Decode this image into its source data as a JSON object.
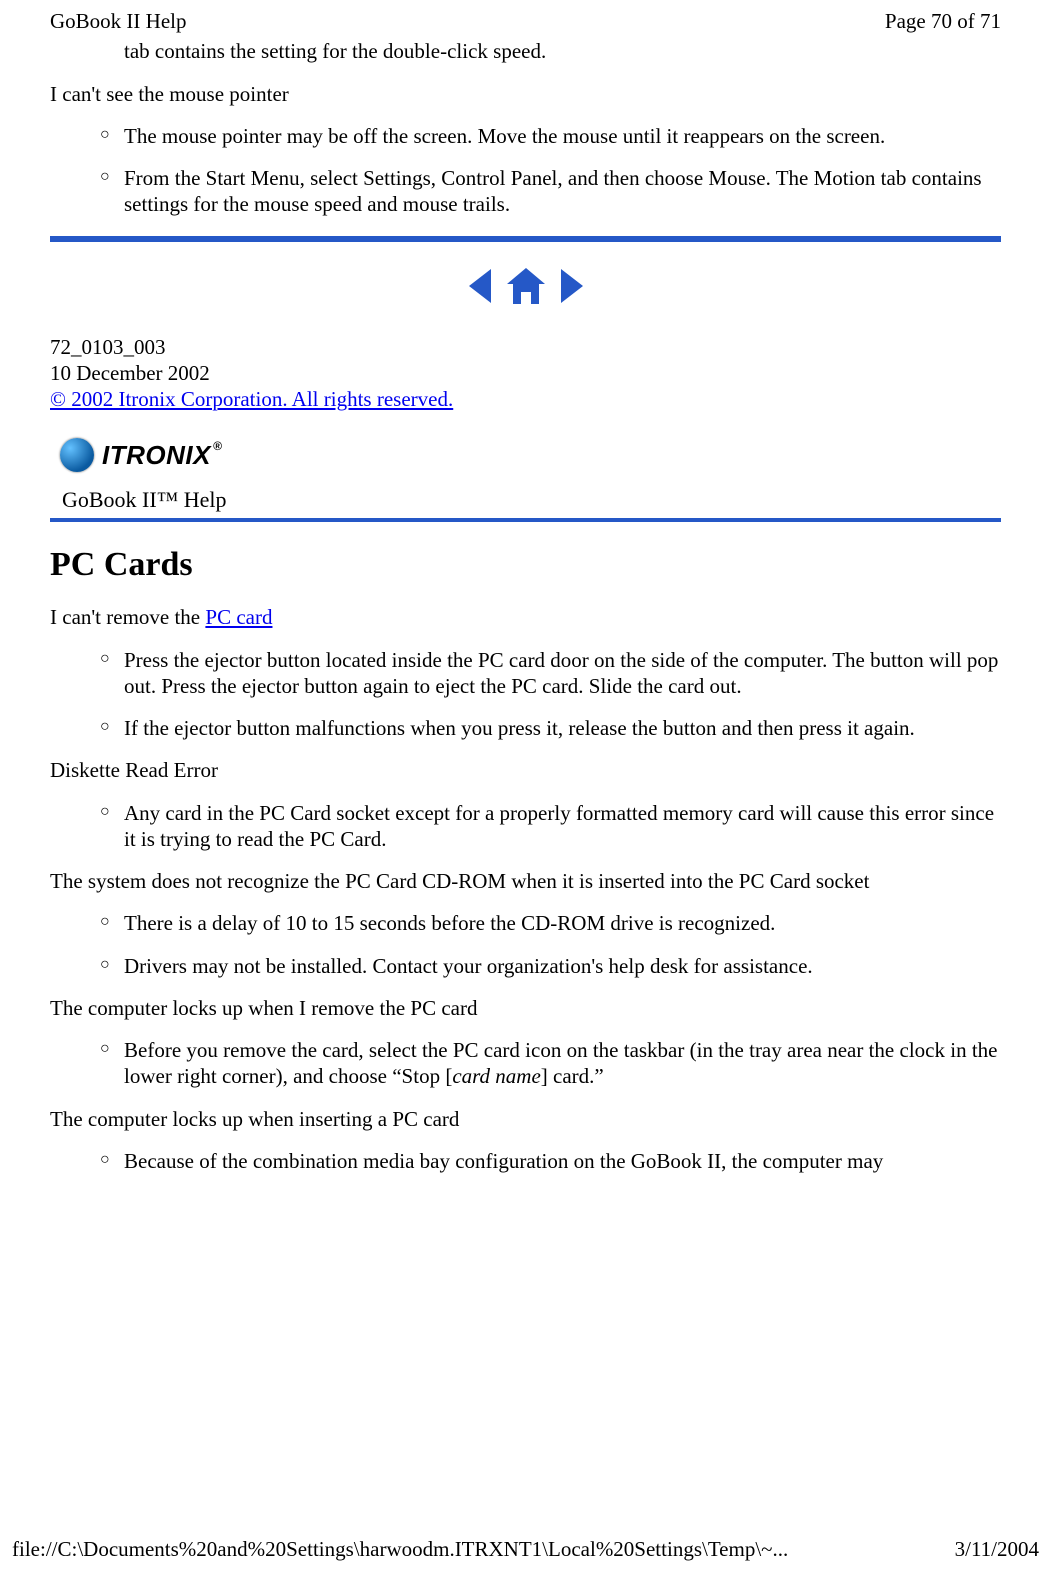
{
  "header": {
    "left": "GoBook II Help",
    "right": "Page 70 of 71"
  },
  "section1": {
    "cont_line": "tab contains the setting for the double-click speed.",
    "topic1": "I can't see the mouse pointer",
    "topic1_items": [
      "The mouse pointer may be off the screen. Move the mouse until it reappears on the screen.",
      "From the Start Menu, select Settings, Control Panel, and then choose Mouse.  The Motion tab contains settings for the mouse speed and mouse trails."
    ]
  },
  "docinfo": {
    "id": "72_0103_003",
    "date": "10 December 2002",
    "copyright": "© 2002 Itronix Corporation.  All rights reserved."
  },
  "logo": {
    "brand": "ITRONIX",
    "subhead": "GoBook II™ Help"
  },
  "section2": {
    "title": "PC Cards",
    "t1_pre": "I can't remove the ",
    "t1_link": "PC card",
    "t1_items": [
      "Press the ejector button located inside the PC card door on the side of the computer. The button will pop out. Press the ejector button again to eject the PC card.  Slide the card out.",
      "If the ejector button malfunctions when you press it, release the button and then press it again."
    ],
    "t2": "Diskette Read Error",
    "t2_items": [
      "Any card in the PC Card socket except for a properly formatted memory card will cause this error since it is trying to read the PC Card."
    ],
    "t3": "The system does not recognize the PC Card CD-ROM when it is inserted into the PC Card socket",
    "t3_items": [
      "There is a delay of 10 to 15 seconds before the CD-ROM drive is recognized.",
      "Drivers may not be installed. Contact your organization's help desk for assistance."
    ],
    "t4": "The computer locks up when I remove the PC card",
    "t4_item_pre": "Before you remove the card, select the PC card icon on the taskbar (in the tray area near the clock in the lower right corner), and choose “Stop [",
    "t4_item_em": "card name",
    "t4_item_post": "] card.”",
    "t5": "The computer locks up when inserting a PC card",
    "t5_items": [
      "Because of the combination media bay configuration on the GoBook II, the computer may"
    ]
  },
  "footer": {
    "left": "file://C:\\Documents%20and%20Settings\\harwoodm.ITRXNT1\\Local%20Settings\\Temp\\~...",
    "right": "3/11/2004"
  }
}
